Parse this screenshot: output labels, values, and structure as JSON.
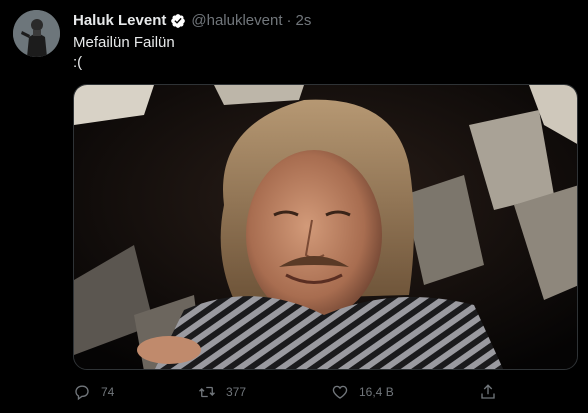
{
  "tweet": {
    "author_name": "Haluk Levent",
    "author_handle": "@halukl​event",
    "separator": "·",
    "time": "2s",
    "text_line1": "Mefailün Failün",
    "text_line2": ":("
  },
  "actions": {
    "reply_count": "74",
    "retweet_count": "377",
    "like_count": "16,4 B"
  },
  "icons": {
    "verified": "verified-badge-icon",
    "reply": "reply-icon",
    "retweet": "retweet-icon",
    "like": "heart-icon",
    "share": "share-icon"
  },
  "colors": {
    "background": "#000000",
    "text": "#e7e9ea",
    "secondary": "#71767b",
    "verified": "#1d9bf0"
  }
}
